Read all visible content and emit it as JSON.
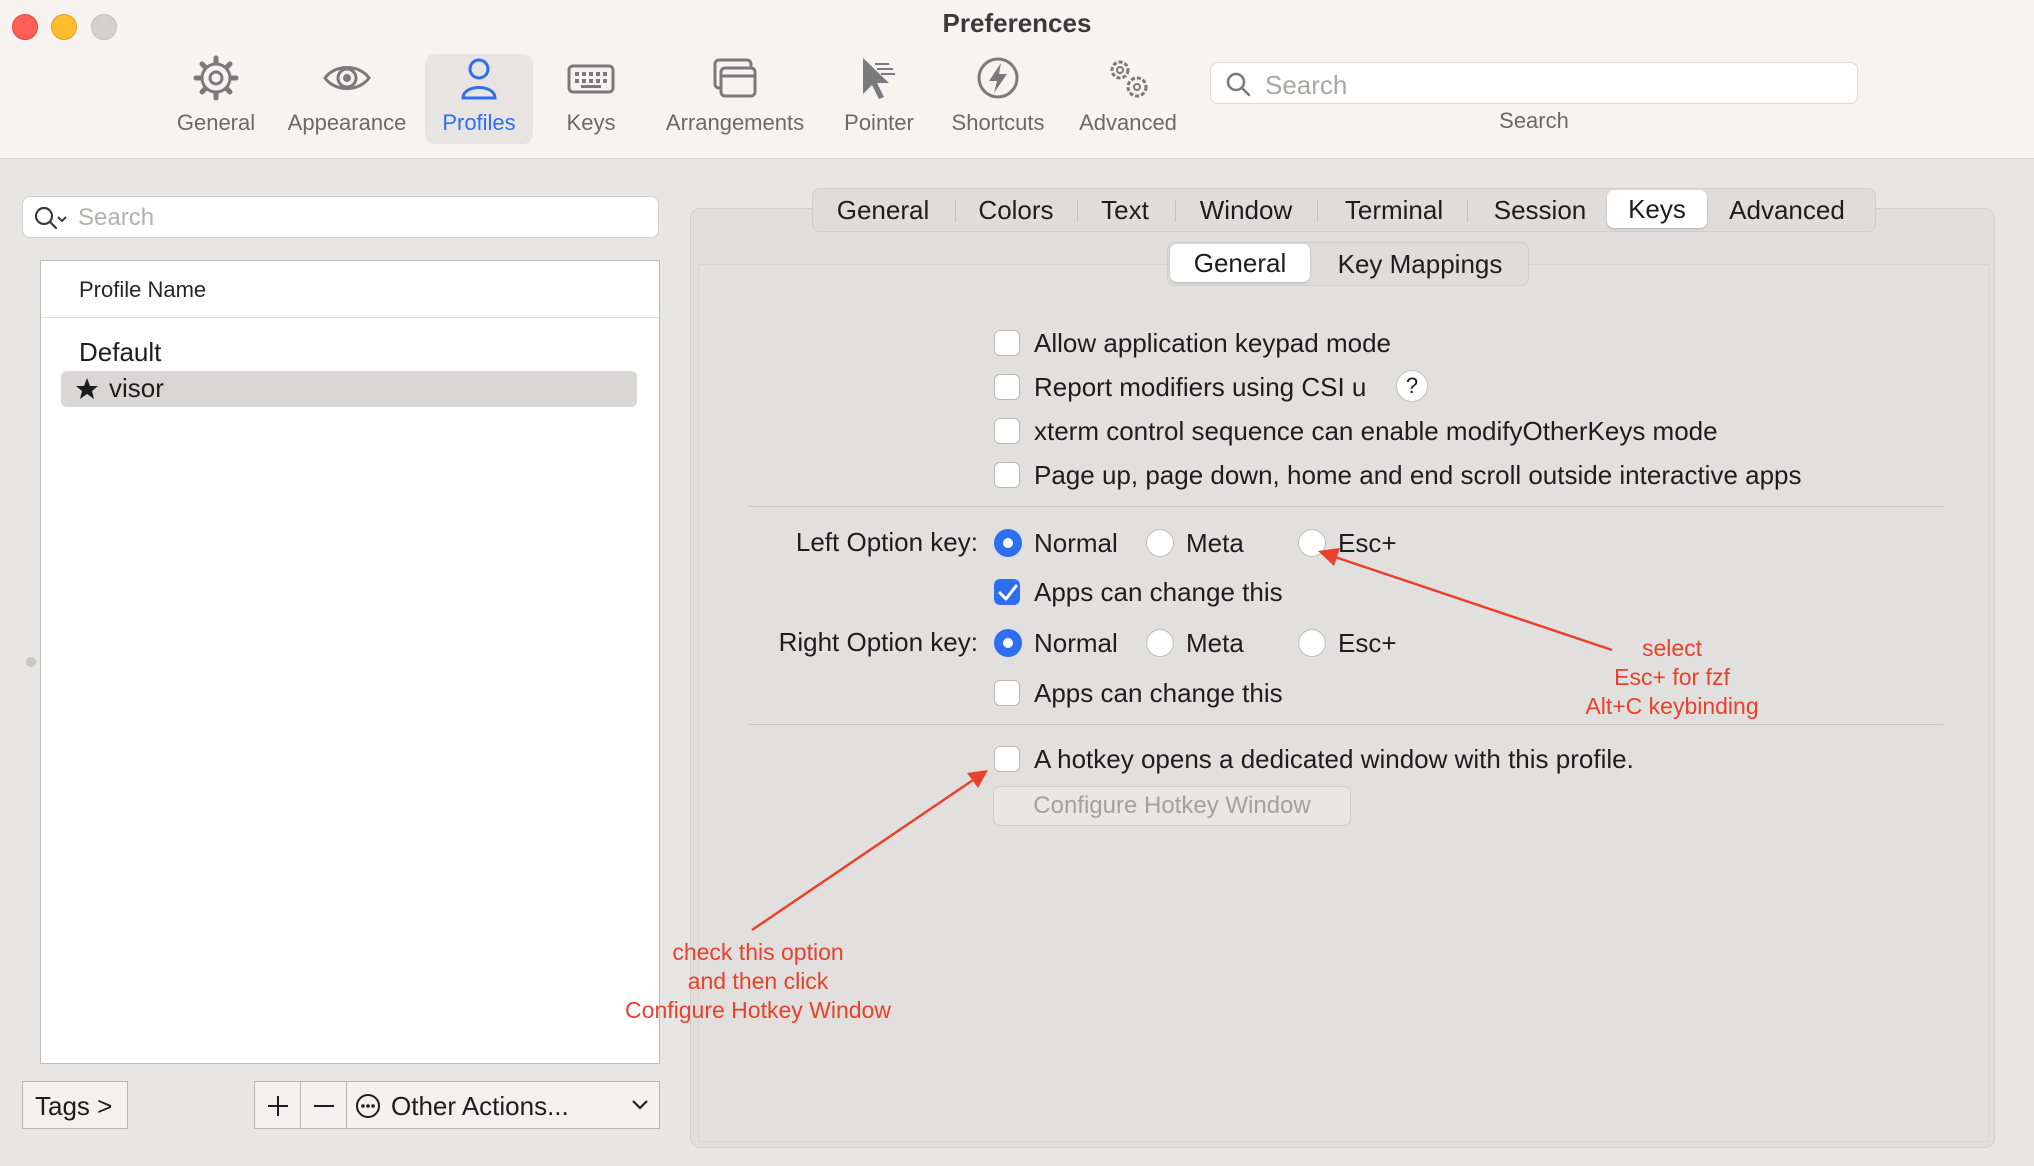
{
  "window": {
    "title": "Preferences"
  },
  "toolbar": {
    "items": [
      {
        "label": "General",
        "icon": "gear-icon",
        "active": false
      },
      {
        "label": "Appearance",
        "icon": "eye-icon",
        "active": false
      },
      {
        "label": "Profiles",
        "icon": "person-icon",
        "active": true
      },
      {
        "label": "Keys",
        "icon": "keyboard-icon",
        "active": false
      },
      {
        "label": "Arrangements",
        "icon": "windows-icon",
        "active": false
      },
      {
        "label": "Pointer",
        "icon": "pointer-icon",
        "active": false
      },
      {
        "label": "Shortcuts",
        "icon": "bolt-icon",
        "active": false
      },
      {
        "label": "Advanced",
        "icon": "gears-icon",
        "active": false
      }
    ],
    "search": {
      "placeholder": "Search",
      "label": "Search"
    }
  },
  "profiles": {
    "search_placeholder": "Search",
    "column_header": "Profile Name",
    "items": [
      {
        "name": "Default",
        "selected": false,
        "starred": false
      },
      {
        "name": "visor",
        "selected": true,
        "starred": true
      }
    ],
    "buttons": {
      "tags": "Tags >",
      "other_actions": "Other Actions..."
    }
  },
  "tabs": {
    "main": [
      "General",
      "Colors",
      "Text",
      "Window",
      "Terminal",
      "Session",
      "Keys",
      "Advanced"
    ],
    "main_active": "Keys",
    "sub": [
      "General",
      "Key Mappings"
    ],
    "sub_active": "General"
  },
  "keys_general": {
    "options": [
      {
        "label": "Allow application keypad mode",
        "checked": false
      },
      {
        "label": "Report modifiers using CSI u",
        "checked": false,
        "help": "?"
      },
      {
        "label": "xterm control sequence can enable modifyOtherKeys mode",
        "checked": false
      },
      {
        "label": "Page up, page down, home and end scroll outside interactive apps",
        "checked": false
      }
    ],
    "left_option": {
      "label": "Left Option key:",
      "choices": [
        "Normal",
        "Meta",
        "Esc+"
      ],
      "selected": "Normal",
      "apps_can_change": {
        "label": "Apps can change this",
        "checked": true
      }
    },
    "right_option": {
      "label": "Right Option key:",
      "choices": [
        "Normal",
        "Meta",
        "Esc+"
      ],
      "selected": "Normal",
      "apps_can_change": {
        "label": "Apps can change this",
        "checked": false
      }
    },
    "hotkey": {
      "label": "A hotkey opens a dedicated window with this profile.",
      "checked": false,
      "configure_button": "Configure Hotkey Window"
    }
  },
  "annotations": {
    "esc": [
      "select",
      "Esc+ for fzf",
      "Alt+C keybinding"
    ],
    "hotkey": [
      "check this option",
      "and then click",
      "Configure Hotkey Window"
    ]
  },
  "colors": {
    "accent": "#2f6ef0",
    "annotation": "#e8412c",
    "close": "#ff5f57",
    "minimize": "#febc2e"
  }
}
